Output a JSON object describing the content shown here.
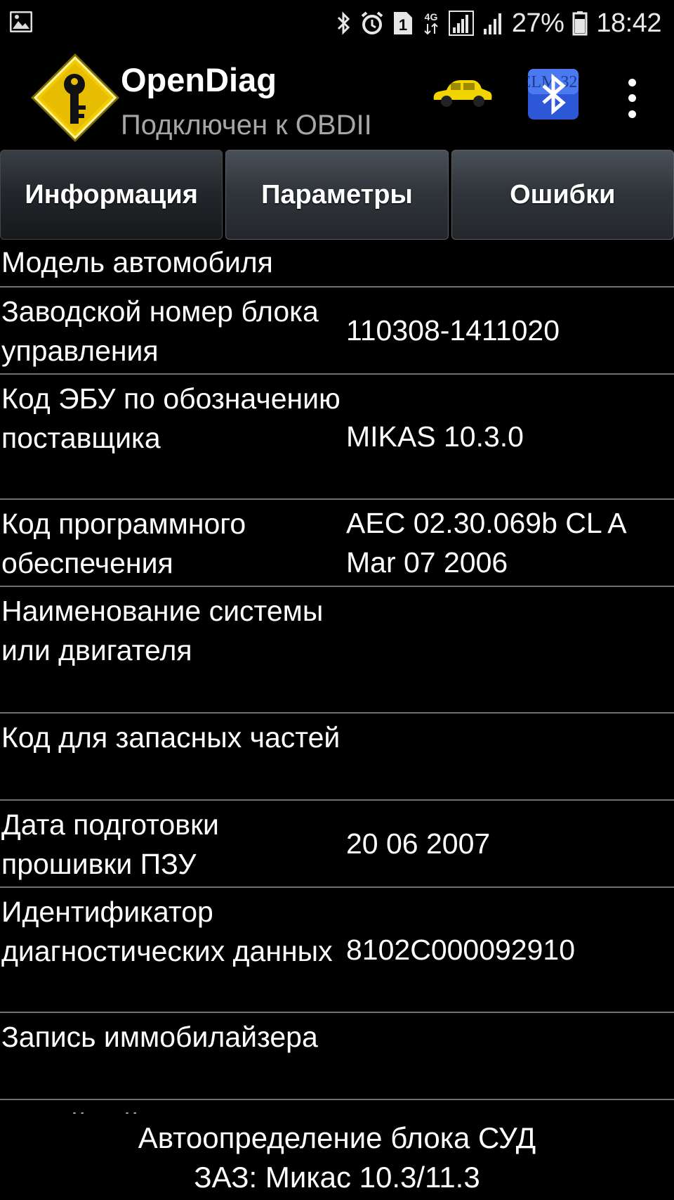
{
  "status_bar": {
    "battery_percent": "27%",
    "time": "18:42",
    "sim_slot": "1",
    "network_type": "4G",
    "icons": [
      "gallery-icon",
      "bluetooth-icon",
      "alarm-icon",
      "sim-icon",
      "4g-icon",
      "signal-icon",
      "signal-icon",
      "battery-icon"
    ]
  },
  "app_bar": {
    "title": "OpenDiag",
    "subtitle": "Подключен к OBDII",
    "car_color": "#f2d500",
    "bt_adapter_label": "ELM 327"
  },
  "tabs": [
    {
      "label": "Информация",
      "active": true
    },
    {
      "label": "Параметры",
      "active": false
    },
    {
      "label": "Ошибки",
      "active": false
    }
  ],
  "info_rows": [
    {
      "label": "Модель автомобиля",
      "value": ""
    },
    {
      "label": "Заводской номер блока управления",
      "value": "110308-1411020"
    },
    {
      "label": "Код ЭБУ по обозначению поставщика",
      "value": "MIKAS 10.3.0"
    },
    {
      "label": "Код программного обеспечения",
      "value": "AEC 02.30.069b CL A Mar 07 2006"
    },
    {
      "label": "Наименование системы или двигателя",
      "value": ""
    },
    {
      "label": "Код для запасных частей",
      "value": ""
    },
    {
      "label": "Дата подготовки прошивки ПЗУ",
      "value": "20 06 2007"
    },
    {
      "label": "Идентификатор диагностических данных",
      "value": "8102C000092910"
    },
    {
      "label": "Запись иммобилайзера",
      "value": ""
    },
    {
      "label": "Серийный номер",
      "value": ""
    }
  ],
  "bottom": {
    "line1": "Автоопределение блока СУД",
    "line2": "ЗАЗ: Микас 10.3/11.3"
  }
}
